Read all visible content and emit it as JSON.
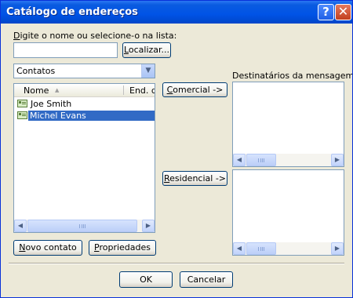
{
  "window": {
    "title": "Catálogo de endereços"
  },
  "title_buttons": {
    "help": "?",
    "close": "✕"
  },
  "search": {
    "label_prefix": "D",
    "label_rest": "igite o nome ou selecione-o na lista:",
    "value": "",
    "find_button_prefix": "L",
    "find_button_rest": "ocalizar..."
  },
  "source": {
    "selected": "Contatos"
  },
  "contacts": {
    "columns": [
      "Nome",
      "End. de"
    ],
    "sort_indicator": "▲",
    "rows": [
      {
        "name": "Joe Smith",
        "selected": false
      },
      {
        "name": "Michel Evans",
        "selected": true
      }
    ]
  },
  "recipients": {
    "label": "Destinatários da mensagem:",
    "commercial_prefix": "C",
    "commercial_rest": "omercial ->",
    "residential_prefix": "R",
    "residential_rest": "esidencial ->",
    "commercial_list": [],
    "residential_list": []
  },
  "actions": {
    "new_contact_prefix": "N",
    "new_contact_rest": "ovo contato",
    "properties_prefix": "P",
    "properties_rest": "ropriedades"
  },
  "footer": {
    "ok": "OK",
    "cancel": "Cancelar"
  },
  "scroll_arrows": {
    "left": "◀",
    "right": "▶",
    "down": "▼"
  },
  "colors": {
    "title_bar": "#0054e3",
    "selection": "#316ac5",
    "dialog_bg": "#ece9d8"
  }
}
